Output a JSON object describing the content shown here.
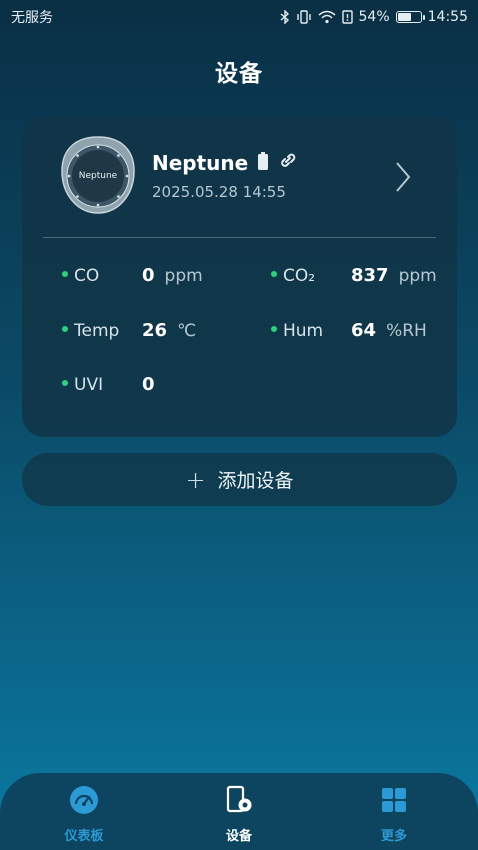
{
  "status_bar": {
    "carrier": "无服务",
    "battery_percent": "54%",
    "battery_level": 0.54,
    "time": "14:55"
  },
  "page": {
    "title": "设备"
  },
  "device": {
    "name": "Neptune",
    "avatar_text": "Neptune",
    "timestamp": "2025.05.28 14:55",
    "metrics": [
      {
        "label": "CO",
        "value": "0",
        "unit": "ppm"
      },
      {
        "label": "CO₂",
        "value": "837",
        "unit": "ppm"
      },
      {
        "label": "Temp",
        "value": "26",
        "unit": "℃"
      },
      {
        "label": "Hum",
        "value": "64",
        "unit": "%RH"
      },
      {
        "label": "UVI",
        "value": "0",
        "unit": ""
      }
    ]
  },
  "add_device": {
    "label": "添加设备"
  },
  "tabs": [
    {
      "label": "仪表板",
      "icon": "dashboard-icon",
      "active": false
    },
    {
      "label": "设备",
      "icon": "device-icon",
      "active": true
    },
    {
      "label": "更多",
      "icon": "grid-icon",
      "active": false
    }
  ],
  "colors": {
    "accent_blue": "#2c9ad4",
    "status_green": "#2fd27a"
  }
}
